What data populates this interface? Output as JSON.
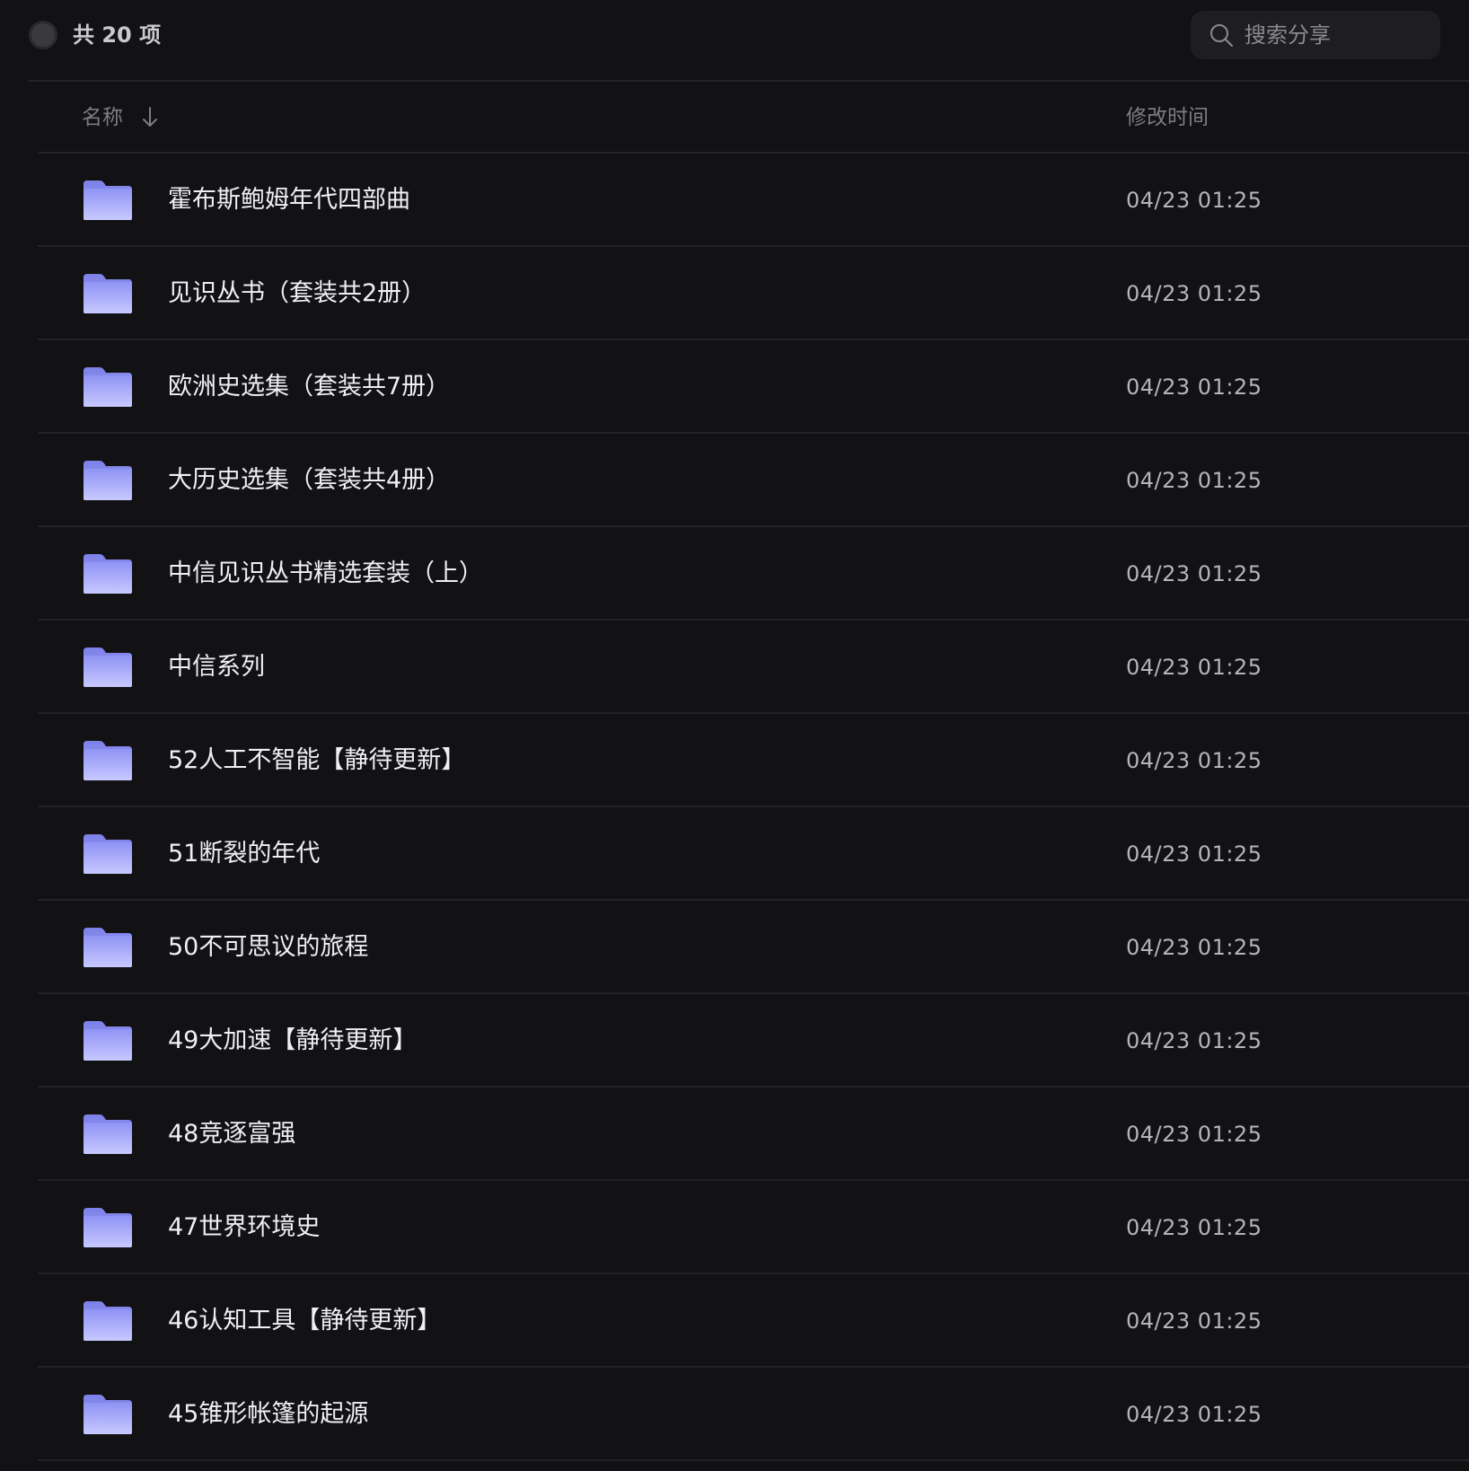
{
  "toolbar": {
    "count_label": "共 20 项",
    "search_placeholder": "搜索分享"
  },
  "columns": {
    "name": "名称",
    "modified": "修改时间"
  },
  "colors": {
    "background": "#121214",
    "folder_top": "#8f93f4",
    "folder_bottom": "#c7c9ff"
  },
  "rows": [
    {
      "name": "霍布斯鲍姆年代四部曲",
      "time": "04/23 01:25"
    },
    {
      "name": "见识丛书（套装共2册）",
      "time": "04/23 01:25"
    },
    {
      "name": "欧洲史选集（套装共7册）",
      "time": "04/23 01:25"
    },
    {
      "name": "大历史选集（套装共4册）",
      "time": "04/23 01:25"
    },
    {
      "name": "中信见识丛书精选套装（上）",
      "time": "04/23 01:25"
    },
    {
      "name": "中信系列",
      "time": "04/23 01:25"
    },
    {
      "name": "52人工不智能【静待更新】",
      "time": "04/23 01:25"
    },
    {
      "name": "51断裂的年代",
      "time": "04/23 01:25"
    },
    {
      "name": "50不可思议的旅程",
      "time": "04/23 01:25"
    },
    {
      "name": "49大加速【静待更新】",
      "time": "04/23 01:25"
    },
    {
      "name": "48竞逐富强",
      "time": "04/23 01:25"
    },
    {
      "name": "47世界环境史",
      "time": "04/23 01:25"
    },
    {
      "name": "46认知工具【静待更新】",
      "time": "04/23 01:25"
    },
    {
      "name": "45锥形帐篷的起源",
      "time": "04/23 01:25"
    }
  ]
}
